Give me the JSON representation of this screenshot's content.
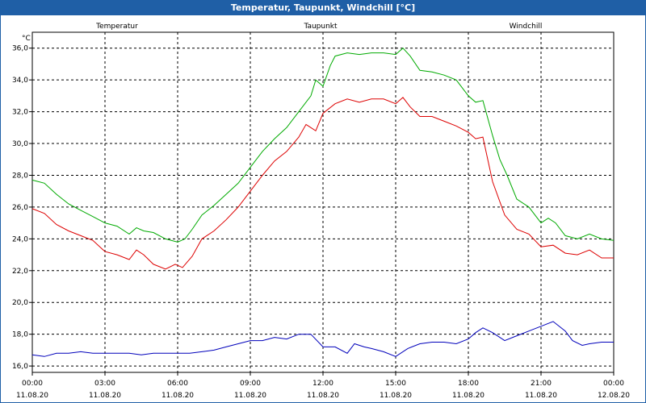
{
  "window": {
    "title": "Temperatur, Taupunkt, Windchill [°C]"
  },
  "chart_data": {
    "type": "line",
    "title": "Temperatur, Taupunkt, Windchill [°C]",
    "ylabel": "°C",
    "xlabel": "",
    "ylim": [
      15.6,
      37.0
    ],
    "xlim": [
      0,
      24
    ],
    "grid": true,
    "legend_position": "top",
    "y_ticks": [
      "16,0",
      "18,0",
      "20,0",
      "22,0",
      "24,0",
      "26,0",
      "28,0",
      "30,0",
      "32,0",
      "34,0",
      "36,0"
    ],
    "x_ticks": [
      {
        "time": "00:00",
        "date": "11.08.20"
      },
      {
        "time": "03:00",
        "date": "11.08.20"
      },
      {
        "time": "06:00",
        "date": "11.08.20"
      },
      {
        "time": "09:00",
        "date": "11.08.20"
      },
      {
        "time": "12:00",
        "date": "11.08.20"
      },
      {
        "time": "15:00",
        "date": "11.08.20"
      },
      {
        "time": "18:00",
        "date": "11.08.20"
      },
      {
        "time": "21:00",
        "date": "11.08.20"
      },
      {
        "time": "00:00",
        "date": "12.08.20"
      }
    ],
    "series": [
      {
        "name": "Temperatur",
        "color": "#dd0000",
        "points": [
          [
            0,
            25.9
          ],
          [
            0.5,
            25.6
          ],
          [
            1,
            24.9
          ],
          [
            1.5,
            24.5
          ],
          [
            2,
            24.2
          ],
          [
            2.5,
            23.9
          ],
          [
            3,
            23.2
          ],
          [
            3.5,
            23.0
          ],
          [
            4,
            22.7
          ],
          [
            4.3,
            23.3
          ],
          [
            4.6,
            23.0
          ],
          [
            5,
            22.4
          ],
          [
            5.5,
            22.1
          ],
          [
            5.9,
            22.4
          ],
          [
            6.2,
            22.2
          ],
          [
            6.6,
            22.9
          ],
          [
            7,
            24.0
          ],
          [
            7.5,
            24.5
          ],
          [
            8,
            25.2
          ],
          [
            8.5,
            26.0
          ],
          [
            9,
            27.0
          ],
          [
            9.5,
            28.0
          ],
          [
            10,
            28.9
          ],
          [
            10.5,
            29.5
          ],
          [
            11,
            30.4
          ],
          [
            11.3,
            31.2
          ],
          [
            11.7,
            30.8
          ],
          [
            12,
            31.9
          ],
          [
            12.5,
            32.5
          ],
          [
            13,
            32.8
          ],
          [
            13.5,
            32.6
          ],
          [
            14,
            32.8
          ],
          [
            14.5,
            32.8
          ],
          [
            15,
            32.5
          ],
          [
            15.3,
            32.9
          ],
          [
            15.6,
            32.3
          ],
          [
            16,
            31.7
          ],
          [
            16.5,
            31.7
          ],
          [
            17,
            31.4
          ],
          [
            17.5,
            31.1
          ],
          [
            18,
            30.7
          ],
          [
            18.3,
            30.3
          ],
          [
            18.6,
            30.4
          ],
          [
            19,
            27.6
          ],
          [
            19.5,
            25.5
          ],
          [
            20,
            24.6
          ],
          [
            20.5,
            24.3
          ],
          [
            21,
            23.5
          ],
          [
            21.5,
            23.6
          ],
          [
            22,
            23.1
          ],
          [
            22.5,
            23.0
          ],
          [
            23,
            23.3
          ],
          [
            23.5,
            22.8
          ],
          [
            24,
            22.8
          ]
        ]
      },
      {
        "name": "Taupunkt",
        "color": "#0000bb",
        "points": [
          [
            0,
            16.7
          ],
          [
            0.5,
            16.6
          ],
          [
            1,
            16.8
          ],
          [
            1.5,
            16.8
          ],
          [
            2,
            16.9
          ],
          [
            2.5,
            16.8
          ],
          [
            3,
            16.8
          ],
          [
            3.5,
            16.8
          ],
          [
            4,
            16.8
          ],
          [
            4.5,
            16.7
          ],
          [
            5,
            16.8
          ],
          [
            5.5,
            16.8
          ],
          [
            6,
            16.8
          ],
          [
            6.5,
            16.8
          ],
          [
            7,
            16.9
          ],
          [
            7.5,
            17.0
          ],
          [
            8,
            17.2
          ],
          [
            8.5,
            17.4
          ],
          [
            9,
            17.6
          ],
          [
            9.5,
            17.6
          ],
          [
            10,
            17.8
          ],
          [
            10.5,
            17.7
          ],
          [
            11,
            18.0
          ],
          [
            11.5,
            18.0
          ],
          [
            12,
            17.2
          ],
          [
            12.5,
            17.2
          ],
          [
            13,
            16.8
          ],
          [
            13.3,
            17.4
          ],
          [
            13.7,
            17.2
          ],
          [
            14,
            17.1
          ],
          [
            14.5,
            16.9
          ],
          [
            15,
            16.6
          ],
          [
            15.5,
            17.1
          ],
          [
            16,
            17.4
          ],
          [
            16.5,
            17.5
          ],
          [
            17,
            17.5
          ],
          [
            17.5,
            17.4
          ],
          [
            18,
            17.7
          ],
          [
            18.3,
            18.1
          ],
          [
            18.6,
            18.4
          ],
          [
            19,
            18.1
          ],
          [
            19.5,
            17.6
          ],
          [
            20,
            17.9
          ],
          [
            20.5,
            18.2
          ],
          [
            21,
            18.5
          ],
          [
            21.5,
            18.8
          ],
          [
            22,
            18.2
          ],
          [
            22.3,
            17.6
          ],
          [
            22.7,
            17.3
          ],
          [
            23,
            17.4
          ],
          [
            23.5,
            17.5
          ],
          [
            24,
            17.5
          ]
        ]
      },
      {
        "name": "Windchill",
        "color": "#00aa00",
        "points": [
          [
            0,
            27.7
          ],
          [
            0.5,
            27.5
          ],
          [
            1,
            26.8
          ],
          [
            1.5,
            26.2
          ],
          [
            2,
            25.8
          ],
          [
            2.5,
            25.4
          ],
          [
            3,
            25.0
          ],
          [
            3.5,
            24.8
          ],
          [
            4,
            24.3
          ],
          [
            4.3,
            24.7
          ],
          [
            4.6,
            24.5
          ],
          [
            5,
            24.4
          ],
          [
            5.5,
            24.0
          ],
          [
            6,
            23.8
          ],
          [
            6.3,
            24.0
          ],
          [
            6.6,
            24.6
          ],
          [
            7,
            25.5
          ],
          [
            7.5,
            26.1
          ],
          [
            8,
            26.8
          ],
          [
            8.5,
            27.5
          ],
          [
            9,
            28.5
          ],
          [
            9.5,
            29.5
          ],
          [
            10,
            30.3
          ],
          [
            10.5,
            31.0
          ],
          [
            11,
            32.0
          ],
          [
            11.5,
            33.0
          ],
          [
            11.7,
            34.0
          ],
          [
            12,
            33.6
          ],
          [
            12.3,
            34.9
          ],
          [
            12.5,
            35.5
          ],
          [
            13,
            35.7
          ],
          [
            13.5,
            35.6
          ],
          [
            14,
            35.7
          ],
          [
            14.5,
            35.7
          ],
          [
            15,
            35.6
          ],
          [
            15.3,
            36.0
          ],
          [
            15.6,
            35.5
          ],
          [
            16,
            34.6
          ],
          [
            16.5,
            34.5
          ],
          [
            17,
            34.3
          ],
          [
            17.5,
            34.0
          ],
          [
            18,
            33.0
          ],
          [
            18.3,
            32.6
          ],
          [
            18.6,
            32.7
          ],
          [
            19,
            30.5
          ],
          [
            19.3,
            29.0
          ],
          [
            19.6,
            28.0
          ],
          [
            20,
            26.5
          ],
          [
            20.5,
            26.0
          ],
          [
            21,
            25.0
          ],
          [
            21.3,
            25.3
          ],
          [
            21.6,
            25.0
          ],
          [
            22,
            24.2
          ],
          [
            22.5,
            24.0
          ],
          [
            23,
            24.3
          ],
          [
            23.5,
            24.0
          ],
          [
            24,
            23.9
          ]
        ]
      }
    ]
  }
}
